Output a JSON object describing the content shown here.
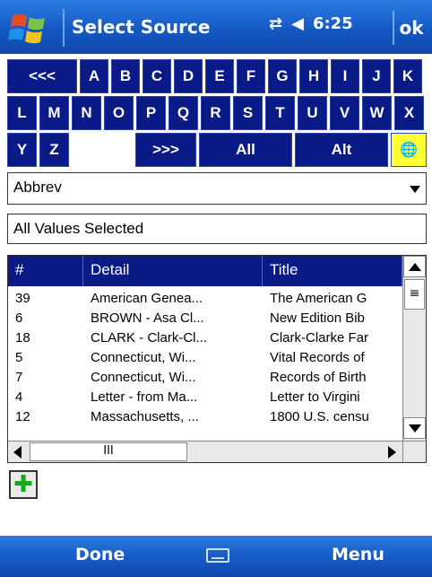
{
  "titlebar": {
    "title": "Select Source",
    "clock": "6:25",
    "ok_label": "ok",
    "icons": [
      "windows-logo-icon",
      "connectivity-icon",
      "volume-icon"
    ]
  },
  "keyboard": {
    "row1": [
      "<<<",
      "A",
      "B",
      "C",
      "D",
      "E",
      "F",
      "G",
      "H",
      "I",
      "J",
      "K"
    ],
    "row2": [
      "L",
      "M",
      "N",
      "O",
      "P",
      "Q",
      "R",
      "S",
      "T",
      "U",
      "V",
      "W",
      "X"
    ],
    "row3": {
      "y": "Y",
      "z": "Z",
      "next": ">>>",
      "all": "All",
      "alt": "Alt"
    }
  },
  "dropdown": {
    "value": "Abbrev"
  },
  "filter_field": {
    "value": "All Values Selected"
  },
  "table": {
    "headers": [
      "#",
      "Detail",
      "Title"
    ],
    "rows": [
      [
        "39",
        "American Genea...",
        "The American G"
      ],
      [
        "6",
        "BROWN - Asa Cl...",
        "New Edition Bib"
      ],
      [
        "18",
        "CLARK - Clark-Cl...",
        "Clark-Clarke Far"
      ],
      [
        "5",
        "Connecticut, Wi...",
        "Vital Records of"
      ],
      [
        "7",
        "Connecticut, Wi...",
        "Records of Birth"
      ],
      [
        "4",
        "Letter - from Ma...",
        "Letter to Virgini"
      ],
      [
        "12",
        "Massachusetts, ...",
        "1800 U.S. censu"
      ]
    ],
    "vscroll_thumb": "≡",
    "hscroll_thumb": "III"
  },
  "menubar": {
    "left": "Done",
    "right": "Menu"
  },
  "colors": {
    "titlebar": "#1559c4",
    "key_bg": "#0a1a87",
    "add_plus": "#19a819"
  }
}
